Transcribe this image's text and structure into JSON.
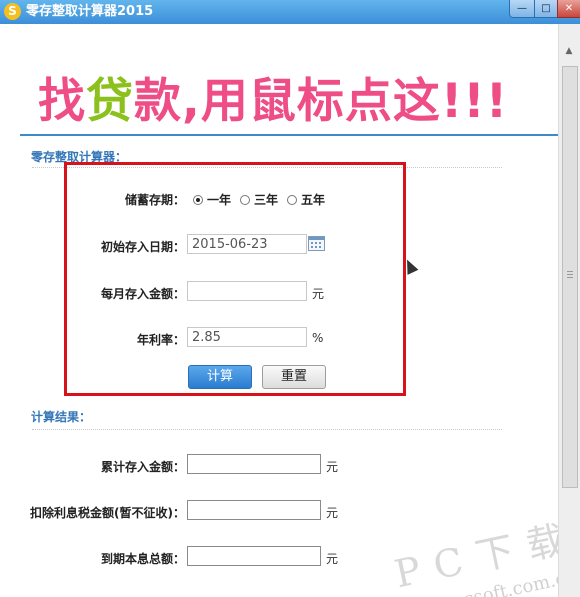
{
  "window": {
    "title": "零存整取计算器2015",
    "app_icon": "S",
    "controls": {
      "minimize": "—",
      "maximize": "□",
      "close": "✕"
    }
  },
  "banner": {
    "part1": "找",
    "part2": "贷",
    "part3": "款,用鼠标点这!!!"
  },
  "calculator": {
    "section_title": "零存整取计算器：",
    "term": {
      "label": "储蓄存期：",
      "options": [
        "一年",
        "三年",
        "五年"
      ],
      "selected": "一年"
    },
    "start_date": {
      "label": "初始存入日期：",
      "value": "2015-06-23"
    },
    "monthly_amount": {
      "label": "每月存入金额：",
      "value": "",
      "unit": "元"
    },
    "rate": {
      "label": "年利率：",
      "value": "2.85",
      "unit": "%"
    },
    "buttons": {
      "calculate": "计算",
      "reset": "重置"
    }
  },
  "results": {
    "section_title": "计算结果：",
    "total_deposit": {
      "label": "累计存入金额：",
      "value": "",
      "unit": "元"
    },
    "interest_after_tax": {
      "label": "扣除利息税金额(暂不征收)：",
      "value": "",
      "unit": "元"
    },
    "maturity_total": {
      "label": "到期本息总额：",
      "value": "",
      "unit": "元"
    }
  },
  "watermark": {
    "main": "PC下载网",
    "url": "www.pcsoft.com.cn"
  },
  "colors": {
    "title_bar": "#3c8fd8",
    "banner_pink": "#ee4d85",
    "banner_green": "#8cc11d",
    "highlight_red": "#d8121a",
    "section_blue": "#3576b8",
    "button_blue": "#2a7cd0"
  }
}
